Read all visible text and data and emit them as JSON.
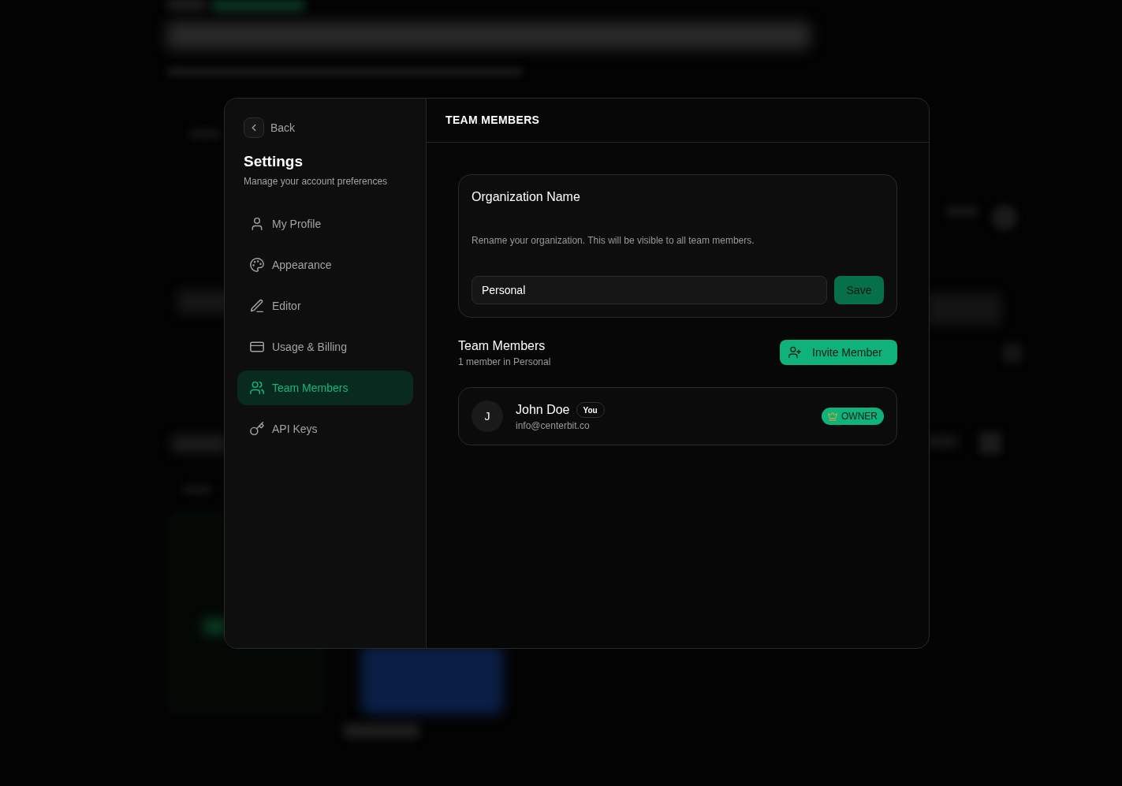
{
  "sidebar": {
    "back_label": "Back",
    "title": "Settings",
    "subtitle": "Manage your account preferences",
    "items": [
      {
        "label": "My Profile",
        "selected": false
      },
      {
        "label": "Appearance",
        "selected": false
      },
      {
        "label": "Editor",
        "selected": false
      },
      {
        "label": "Usage & Billing",
        "selected": false
      },
      {
        "label": "Team Members",
        "selected": true
      },
      {
        "label": "API Keys",
        "selected": false
      }
    ]
  },
  "header": {
    "title": "TEAM MEMBERS"
  },
  "organization": {
    "title": "Organization Name",
    "description": "Rename your organization. This will be visible to all team members.",
    "name_field": {
      "value": "Personal"
    },
    "save_button": "Save"
  },
  "team": {
    "title": "Team Members",
    "subtitle": "1 member in Personal",
    "invite_button": "Invite Member",
    "members": [
      {
        "initial": "J",
        "name": "John Doe",
        "badge": "You",
        "email": "info@centerbit.co",
        "role": "OWNER"
      }
    ]
  }
}
